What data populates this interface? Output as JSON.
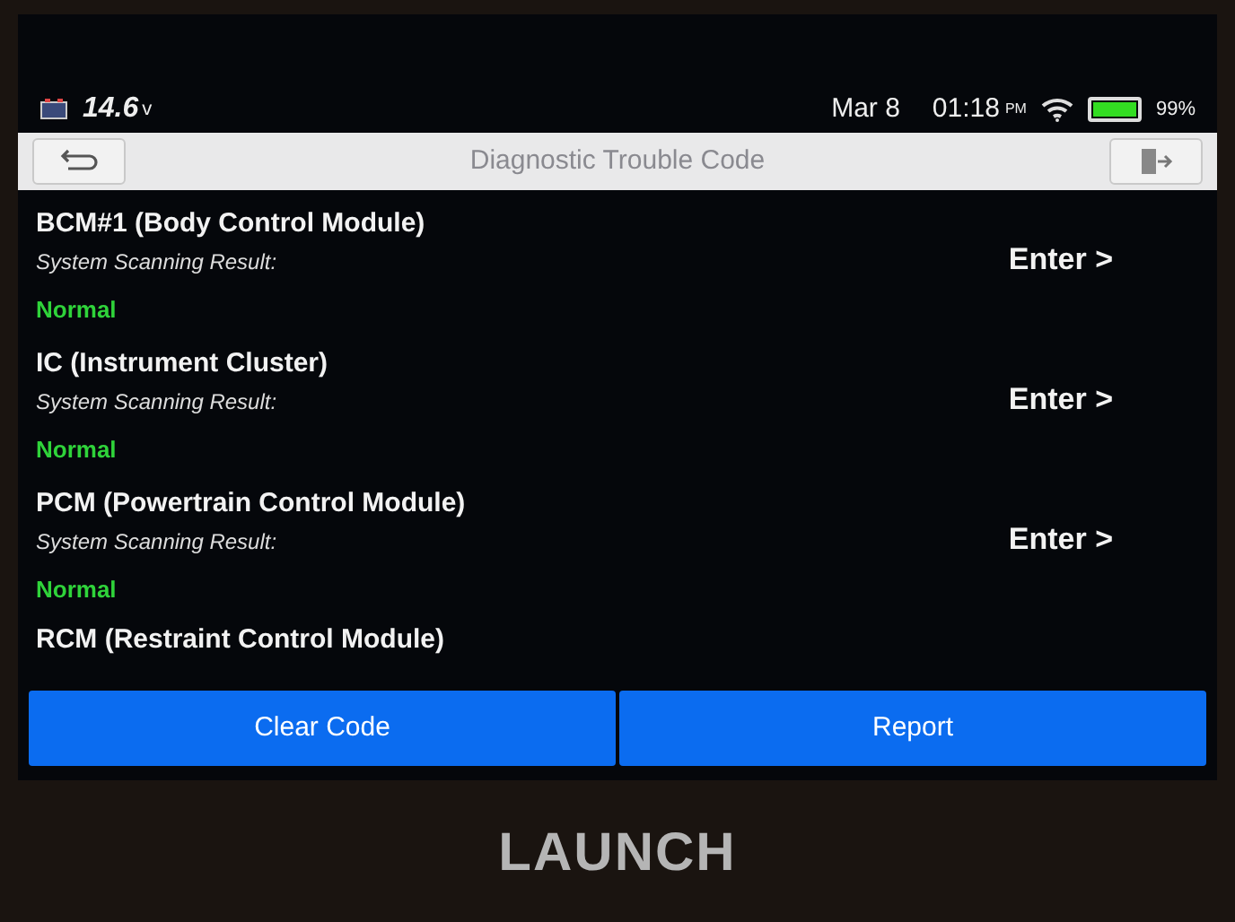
{
  "status_bar": {
    "voltage": "14.6",
    "voltage_unit": "v",
    "date": "Mar 8",
    "time": "01:18",
    "meridiem": "PM",
    "battery": {
      "level": 0.99,
      "reading": "99%"
    }
  },
  "header": {
    "title": "Diagnostic Trouble Code"
  },
  "modules": [
    {
      "name": "BCM#1 (Body Control Module)",
      "result_label": "System Scanning Result:",
      "result": "Normal",
      "action": "Enter >"
    },
    {
      "name": "IC (Instrument Cluster)",
      "result_label": "System Scanning Result:",
      "result": "Normal",
      "action": "Enter >"
    },
    {
      "name": "PCM (Powertrain Control Module)",
      "result_label": "System Scanning Result:",
      "result": "Normal",
      "action": "Enter >"
    },
    {
      "name": "RCM (Restraint Control Module)"
    }
  ],
  "buttons": [
    "Clear Code",
    "Report"
  ],
  "device": {
    "brand": "LAUNCH"
  }
}
